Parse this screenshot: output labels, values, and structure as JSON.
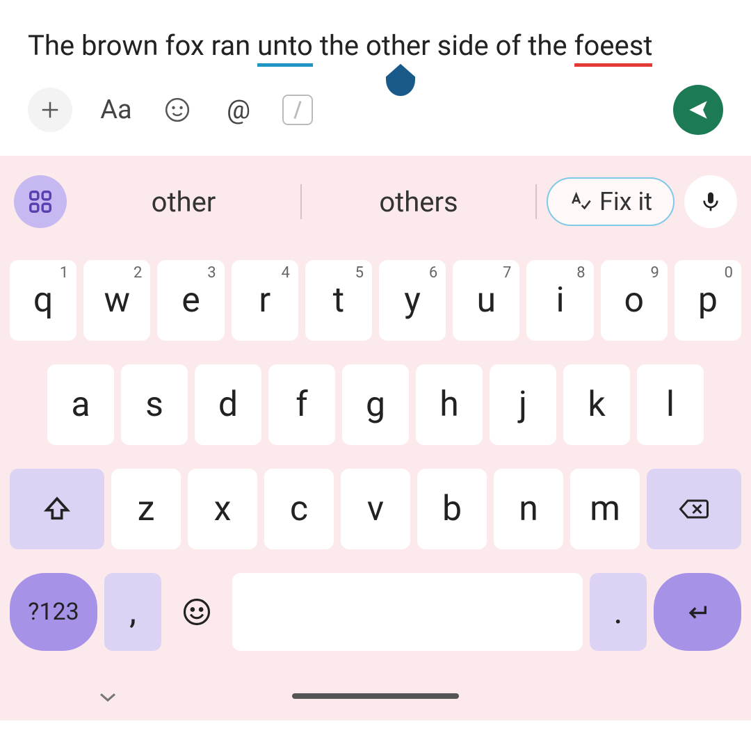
{
  "text": {
    "before_unto": "The brown fox ran ",
    "unto": "unto",
    "middle": " the other side of the ",
    "foeest": "foeest"
  },
  "toolbar": {
    "aa": "Aa",
    "at": "@"
  },
  "suggestions": {
    "s1": "other",
    "s2": "others",
    "fixit": "Fix it"
  },
  "keys": {
    "row1": [
      {
        "k": "q",
        "s": "1"
      },
      {
        "k": "w",
        "s": "2"
      },
      {
        "k": "e",
        "s": "3"
      },
      {
        "k": "r",
        "s": "4"
      },
      {
        "k": "t",
        "s": "5"
      },
      {
        "k": "y",
        "s": "6"
      },
      {
        "k": "u",
        "s": "7"
      },
      {
        "k": "i",
        "s": "8"
      },
      {
        "k": "o",
        "s": "9"
      },
      {
        "k": "p",
        "s": "0"
      }
    ],
    "row2": [
      "a",
      "s",
      "d",
      "f",
      "g",
      "h",
      "j",
      "k",
      "l"
    ],
    "row3": [
      "z",
      "x",
      "c",
      "v",
      "b",
      "n",
      "m"
    ],
    "sym": "?123",
    "comma": ",",
    "period": "."
  }
}
